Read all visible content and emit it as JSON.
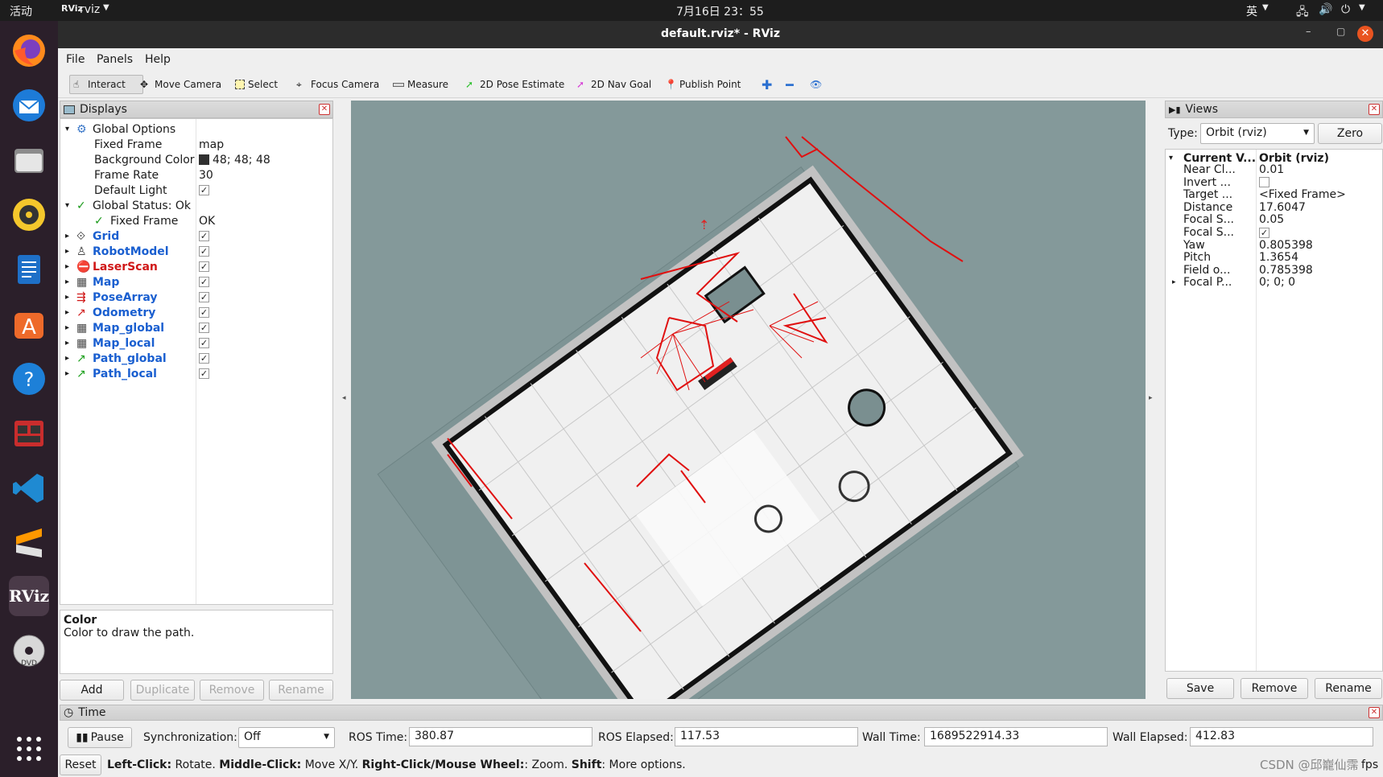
{
  "topbar": {
    "activities": "活动",
    "app": "rviz",
    "clock": "7月16日  23：55",
    "lang": "英"
  },
  "window": {
    "title": "default.rviz* - RViz"
  },
  "menu": {
    "file": "File",
    "panels": "Panels",
    "help": "Help"
  },
  "toolbar": {
    "interact": "Interact",
    "move_camera": "Move Camera",
    "select": "Select",
    "focus_camera": "Focus Camera",
    "measure": "Measure",
    "pose_estimate": "2D Pose Estimate",
    "nav_goal": "2D Nav Goal",
    "publish_point": "Publish Point"
  },
  "displays": {
    "title": "Displays",
    "global_options": "Global Options",
    "fixed_frame_label": "Fixed Frame",
    "fixed_frame_value": "map",
    "bg_label": "Background Color",
    "bg_value": "48; 48; 48",
    "frame_rate_label": "Frame Rate",
    "frame_rate_value": "30",
    "default_light_label": "Default Light",
    "global_status": "Global Status: Ok",
    "status_fixed_frame": "Fixed Frame",
    "status_value": "OK",
    "items": [
      {
        "label": "Grid",
        "color": "blue"
      },
      {
        "label": "RobotModel",
        "color": "blue"
      },
      {
        "label": "LaserScan",
        "color": "red"
      },
      {
        "label": "Map",
        "color": "blue"
      },
      {
        "label": "PoseArray",
        "color": "blue"
      },
      {
        "label": "Odometry",
        "color": "blue"
      },
      {
        "label": "Map_global",
        "color": "blue"
      },
      {
        "label": "Map_local",
        "color": "blue"
      },
      {
        "label": "Path_global",
        "color": "blue"
      },
      {
        "label": "Path_local",
        "color": "blue"
      }
    ],
    "desc_title": "Color",
    "desc_text": "Color to draw the path.",
    "add": "Add",
    "duplicate": "Duplicate",
    "remove": "Remove",
    "rename": "Rename"
  },
  "views": {
    "title": "Views",
    "type_label": "Type:",
    "type_value": "Orbit (rviz)",
    "zero": "Zero",
    "current_label": "Current V...",
    "current_value": "Orbit (rviz)",
    "props": [
      {
        "k": "Near Cl...",
        "v": "0.01"
      },
      {
        "k": "Invert ...",
        "v": ""
      },
      {
        "k": "Target ...",
        "v": "<Fixed Frame>"
      },
      {
        "k": "Distance",
        "v": "17.6047"
      },
      {
        "k": "Focal S...",
        "v": "0.05"
      },
      {
        "k": "Focal S...",
        "v": ""
      },
      {
        "k": "Yaw",
        "v": "0.805398"
      },
      {
        "k": "Pitch",
        "v": "1.3654"
      },
      {
        "k": "Field o...",
        "v": "0.785398"
      },
      {
        "k": "Focal P...",
        "v": "0; 0; 0"
      }
    ],
    "save": "Save",
    "remove": "Remove",
    "rename": "Rename"
  },
  "time": {
    "title": "Time",
    "pause": "Pause",
    "sync_label": "Synchronization:",
    "sync_value": "Off",
    "ros_time_label": "ROS Time:",
    "ros_time": "380.87",
    "ros_elapsed_label": "ROS Elapsed:",
    "ros_elapsed": "117.53",
    "wall_time_label": "Wall Time:",
    "wall_time": "1689522914.33",
    "wall_elapsed_label": "Wall Elapsed:",
    "wall_elapsed": "412.83"
  },
  "status": {
    "reset": "Reset",
    "b1": "Left-Click:",
    "t1": " Rotate. ",
    "b2": "Middle-Click:",
    "t2": " Move X/Y. ",
    "b3": "Right-Click/Mouse Wheel:",
    "t3": ": Zoom. ",
    "b4": "Shift",
    "t4": ": More options.",
    "watermark": "CSDN @邱巃仙霈",
    "fps": "fps"
  }
}
